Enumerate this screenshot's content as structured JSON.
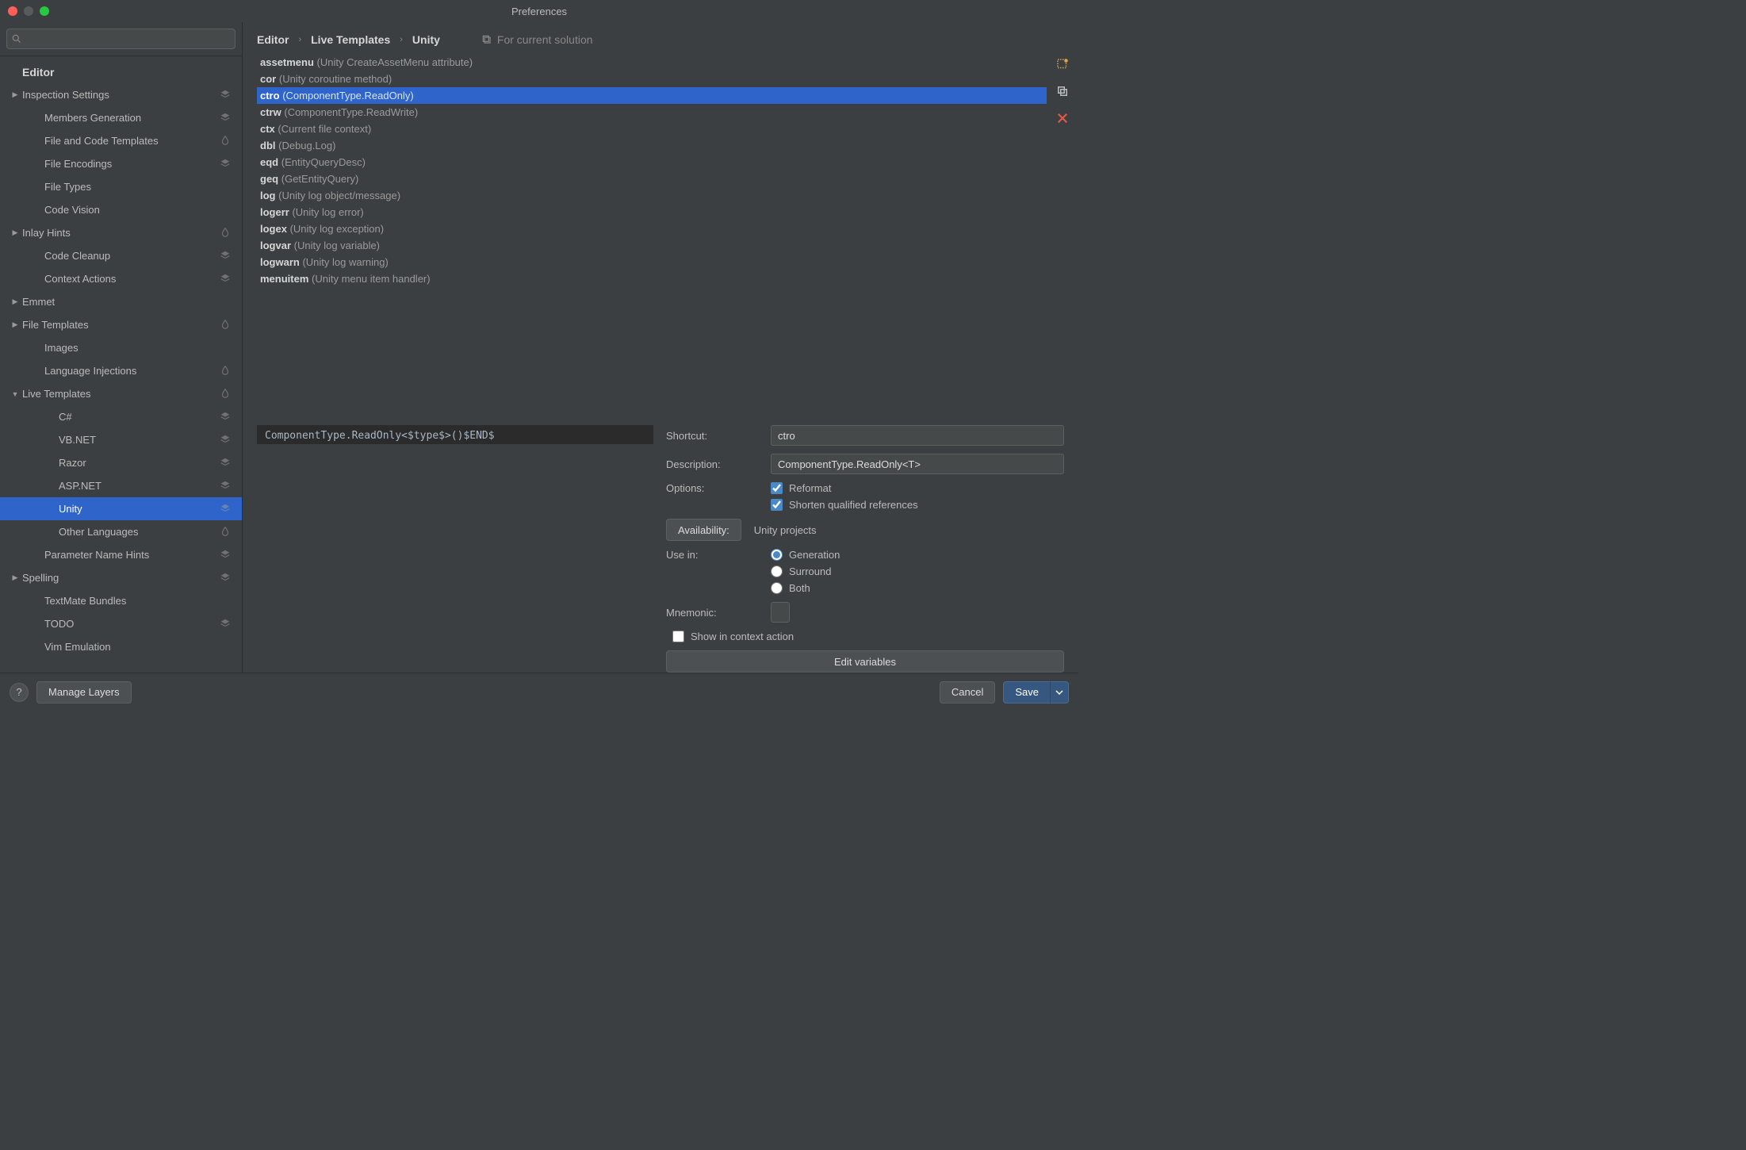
{
  "window": {
    "title": "Preferences"
  },
  "search": {
    "placeholder": ""
  },
  "breadcrumbs": [
    "Editor",
    "Live Templates",
    "Unity"
  ],
  "scope": {
    "label": "For current solution"
  },
  "sidebar": {
    "header": "Editor",
    "items": [
      {
        "label": "Inspection Settings",
        "depth": 0,
        "arrow": "▶",
        "badge": "layers"
      },
      {
        "label": "Members Generation",
        "depth": 1,
        "badge": "layers"
      },
      {
        "label": "File and Code Templates",
        "depth": 1,
        "badge": "droplet"
      },
      {
        "label": "File Encodings",
        "depth": 1,
        "badge": "layers"
      },
      {
        "label": "File Types",
        "depth": 1
      },
      {
        "label": "Code Vision",
        "depth": 1
      },
      {
        "label": "Inlay Hints",
        "depth": 0,
        "arrow": "▶",
        "badge": "droplet"
      },
      {
        "label": "Code Cleanup",
        "depth": 1,
        "badge": "layers"
      },
      {
        "label": "Context Actions",
        "depth": 1,
        "badge": "layers"
      },
      {
        "label": "Emmet",
        "depth": 0,
        "arrow": "▶"
      },
      {
        "label": "File Templates",
        "depth": 0,
        "arrow": "▶",
        "badge": "droplet"
      },
      {
        "label": "Images",
        "depth": 1
      },
      {
        "label": "Language Injections",
        "depth": 1,
        "badge": "droplet"
      },
      {
        "label": "Live Templates",
        "depth": 0,
        "arrow": "▼",
        "badge": "droplet"
      },
      {
        "label": "C#",
        "depth": 2,
        "badge": "layers"
      },
      {
        "label": "VB.NET",
        "depth": 2,
        "badge": "layers"
      },
      {
        "label": "Razor",
        "depth": 2,
        "badge": "layers"
      },
      {
        "label": "ASP.NET",
        "depth": 2,
        "badge": "layers"
      },
      {
        "label": "Unity",
        "depth": 2,
        "badge": "layers",
        "selected": true
      },
      {
        "label": "Other Languages",
        "depth": 2,
        "badge": "droplet"
      },
      {
        "label": "Parameter Name Hints",
        "depth": 1,
        "badge": "layers"
      },
      {
        "label": "Spelling",
        "depth": 0,
        "arrow": "▶",
        "badge": "layers"
      },
      {
        "label": "TextMate Bundles",
        "depth": 1
      },
      {
        "label": "TODO",
        "depth": 1,
        "badge": "layers"
      },
      {
        "label": "Vim Emulation",
        "depth": 1
      }
    ]
  },
  "templates": [
    {
      "name": "assetmenu",
      "desc": "(Unity CreateAssetMenu attribute)"
    },
    {
      "name": "cor",
      "desc": "(Unity coroutine method)"
    },
    {
      "name": "ctro",
      "desc": "(ComponentType.ReadOnly<T>)",
      "selected": true
    },
    {
      "name": "ctrw",
      "desc": "(ComponentType.ReadWrite<T>)"
    },
    {
      "name": "ctx",
      "desc": "(Current file context)"
    },
    {
      "name": "dbl",
      "desc": "(Debug.Log)"
    },
    {
      "name": "eqd",
      "desc": "(EntityQueryDesc)"
    },
    {
      "name": "geq",
      "desc": "(GetEntityQuery)"
    },
    {
      "name": "log",
      "desc": "(Unity log object/message)"
    },
    {
      "name": "logerr",
      "desc": "(Unity log error)"
    },
    {
      "name": "logex",
      "desc": "(Unity log exception)"
    },
    {
      "name": "logvar",
      "desc": "(Unity log variable)"
    },
    {
      "name": "logwarn",
      "desc": "(Unity log warning)"
    },
    {
      "name": "menuitem",
      "desc": "(Unity menu item handler)"
    }
  ],
  "editor": {
    "code": "ComponentType.ReadOnly<$type$>()$END$"
  },
  "form": {
    "shortcut_label": "Shortcut:",
    "shortcut_value": "ctro",
    "description_label": "Description:",
    "description_value": "ComponentType.ReadOnly<T>",
    "options_label": "Options:",
    "reformat": "Reformat",
    "shorten": "Shorten qualified references",
    "availability_btn": "Availability:",
    "availability_value": "Unity projects",
    "usein_label": "Use in:",
    "usein_generation": "Generation",
    "usein_surround": "Surround",
    "usein_both": "Both",
    "mnemonic_label": "Mnemonic:",
    "show_in_context": "Show in context action",
    "edit_vars": "Edit variables"
  },
  "footer": {
    "help": "?",
    "manage_layers": "Manage Layers",
    "cancel": "Cancel",
    "save": "Save"
  }
}
